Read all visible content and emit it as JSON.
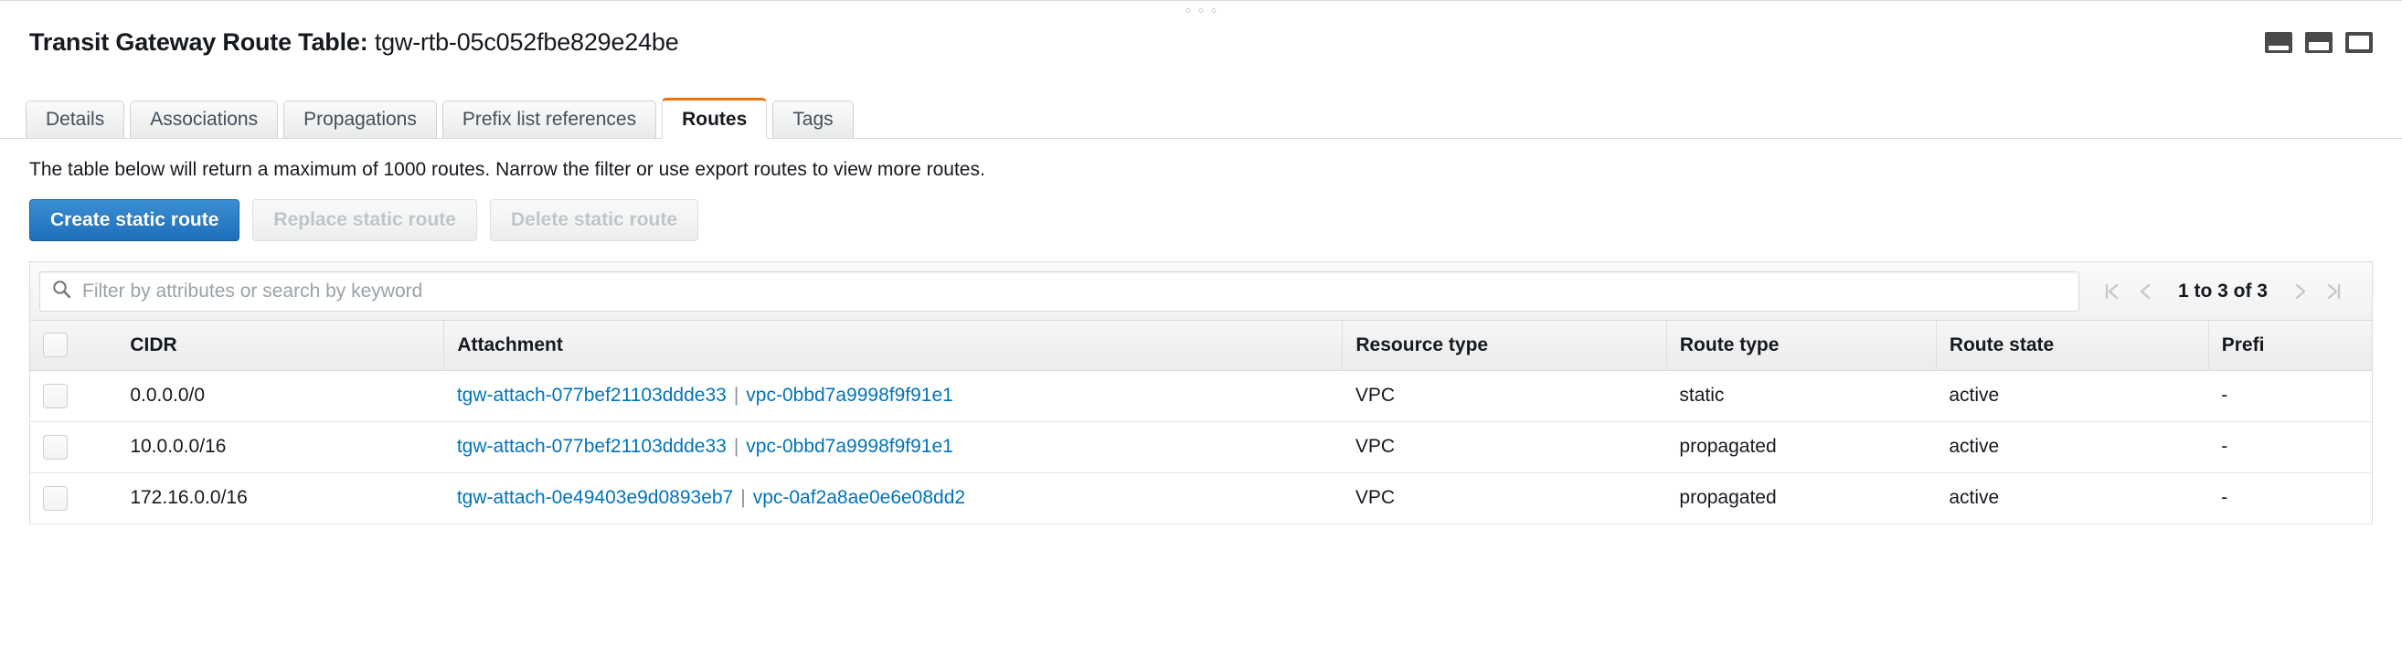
{
  "header": {
    "title_label": "Transit Gateway Route Table:",
    "title_value": "tgw-rtb-05c052fbe829e24be",
    "window_icons": [
      {
        "name": "layout-bottom-panel-icon",
        "label": "Bottom panel layout"
      },
      {
        "name": "layout-split-panel-icon",
        "label": "Split panel layout"
      },
      {
        "name": "layout-full-panel-icon",
        "label": "Full panel layout"
      }
    ]
  },
  "tabs": [
    {
      "label": "Details",
      "active": false
    },
    {
      "label": "Associations",
      "active": false
    },
    {
      "label": "Propagations",
      "active": false
    },
    {
      "label": "Prefix list references",
      "active": false
    },
    {
      "label": "Routes",
      "active": true
    },
    {
      "label": "Tags",
      "active": false
    }
  ],
  "notice": "The table below will return a maximum of 1000 routes. Narrow the filter or use export routes to view more routes.",
  "actions": {
    "create_static_route": "Create static route",
    "replace_static_route": "Replace static route",
    "delete_static_route": "Delete static route"
  },
  "search": {
    "placeholder": "Filter by attributes or search by keyword",
    "value": ""
  },
  "pagination": {
    "first": "|<",
    "prev": "<",
    "label": "1 to 3 of 3",
    "next": ">",
    "last": ">|"
  },
  "table": {
    "columns": [
      "CIDR",
      "Attachment",
      "Resource type",
      "Route type",
      "Route state",
      "Prefi"
    ],
    "rows": [
      {
        "cidr": "0.0.0.0/0",
        "attachment_id": "tgw-attach-077bef21103ddde33",
        "attachment_separator": "|",
        "vpc_id": "vpc-0bbd7a9998f9f91e1",
        "resource_type": "VPC",
        "route_type": "static",
        "route_state": "active",
        "prefix_list_id": "-"
      },
      {
        "cidr": "10.0.0.0/16",
        "attachment_id": "tgw-attach-077bef21103ddde33",
        "attachment_separator": "|",
        "vpc_id": "vpc-0bbd7a9998f9f91e1",
        "resource_type": "VPC",
        "route_type": "propagated",
        "route_state": "active",
        "prefix_list_id": "-"
      },
      {
        "cidr": "172.16.0.0/16",
        "attachment_id": "tgw-attach-0e49403e9d0893eb7",
        "attachment_separator": "|",
        "vpc_id": "vpc-0af2a8ae0e6e08dd2",
        "resource_type": "VPC",
        "route_type": "propagated",
        "route_state": "active",
        "prefix_list_id": "-"
      }
    ]
  },
  "colors": {
    "accent_orange": "#ec7211",
    "link_blue": "#0073bb",
    "primary_button_blue": "#1d6fba"
  }
}
